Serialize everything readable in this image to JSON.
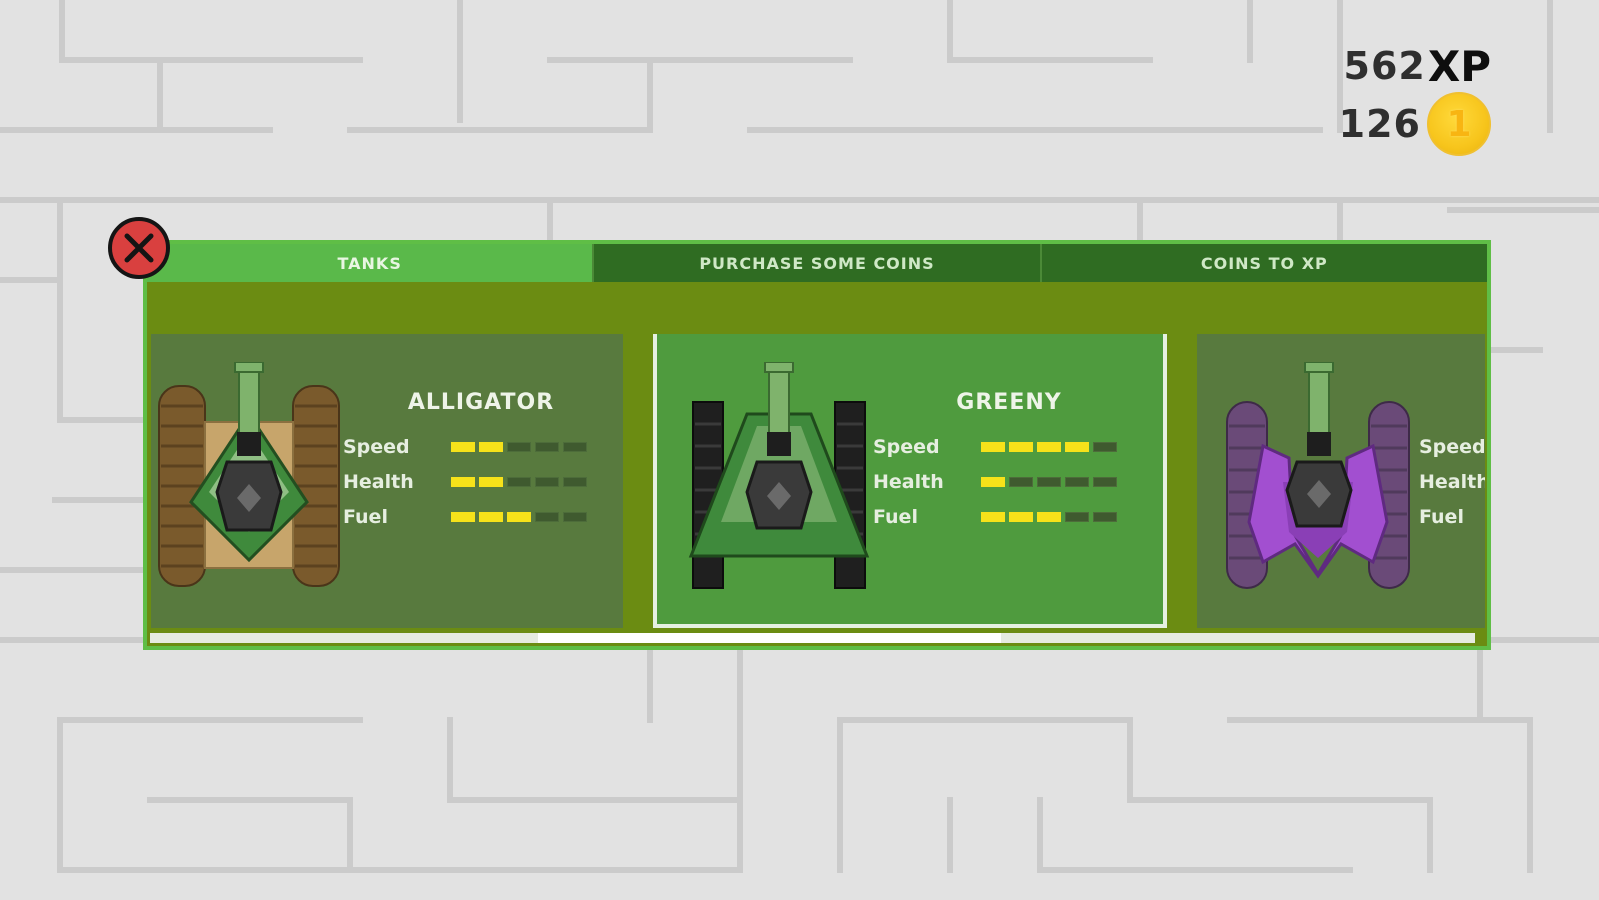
{
  "hud": {
    "xp_value": "562",
    "xp_unit": "XP",
    "coins_value": "126",
    "coin_glyph": "1"
  },
  "tabs": [
    {
      "label": "TANKS",
      "active": true
    },
    {
      "label": "PURCHASE SOME COINS",
      "active": false
    },
    {
      "label": "COINS TO XP",
      "active": false
    }
  ],
  "stat_max": 5,
  "tanks": [
    {
      "name": "ALLIGATOR",
      "skin": "alligator",
      "selected": false,
      "stats": [
        {
          "label": "Speed",
          "value": 2
        },
        {
          "label": "Health",
          "value": 2
        },
        {
          "label": "Fuel",
          "value": 3
        }
      ]
    },
    {
      "name": "GREENY",
      "skin": "greeny",
      "selected": true,
      "stats": [
        {
          "label": "Speed",
          "value": 4
        },
        {
          "label": "Health",
          "value": 1
        },
        {
          "label": "Fuel",
          "value": 3
        }
      ]
    },
    {
      "name": "",
      "skin": "purple",
      "selected": false,
      "stats": [
        {
          "label": "Speed",
          "value": 0
        },
        {
          "label": "Health",
          "value": 0
        },
        {
          "label": "Fuel",
          "value": 0
        }
      ]
    }
  ],
  "scroll": {
    "position": 0.45,
    "visible_fraction": 0.35
  },
  "colors": {
    "panel_bg": "#6b8c12",
    "panel_border": "#5fbe46",
    "tab_active": "#5ab94a",
    "tab_inactive": "#2f6c22",
    "card_bg": "#587a3e",
    "card_selected_bg": "#4f9b3e",
    "stat_pip_on": "#f6e21a",
    "coin": "#f7c51c",
    "close_button": "#d9403f"
  },
  "icons": {
    "close": "close-icon",
    "coin": "coin-icon"
  }
}
